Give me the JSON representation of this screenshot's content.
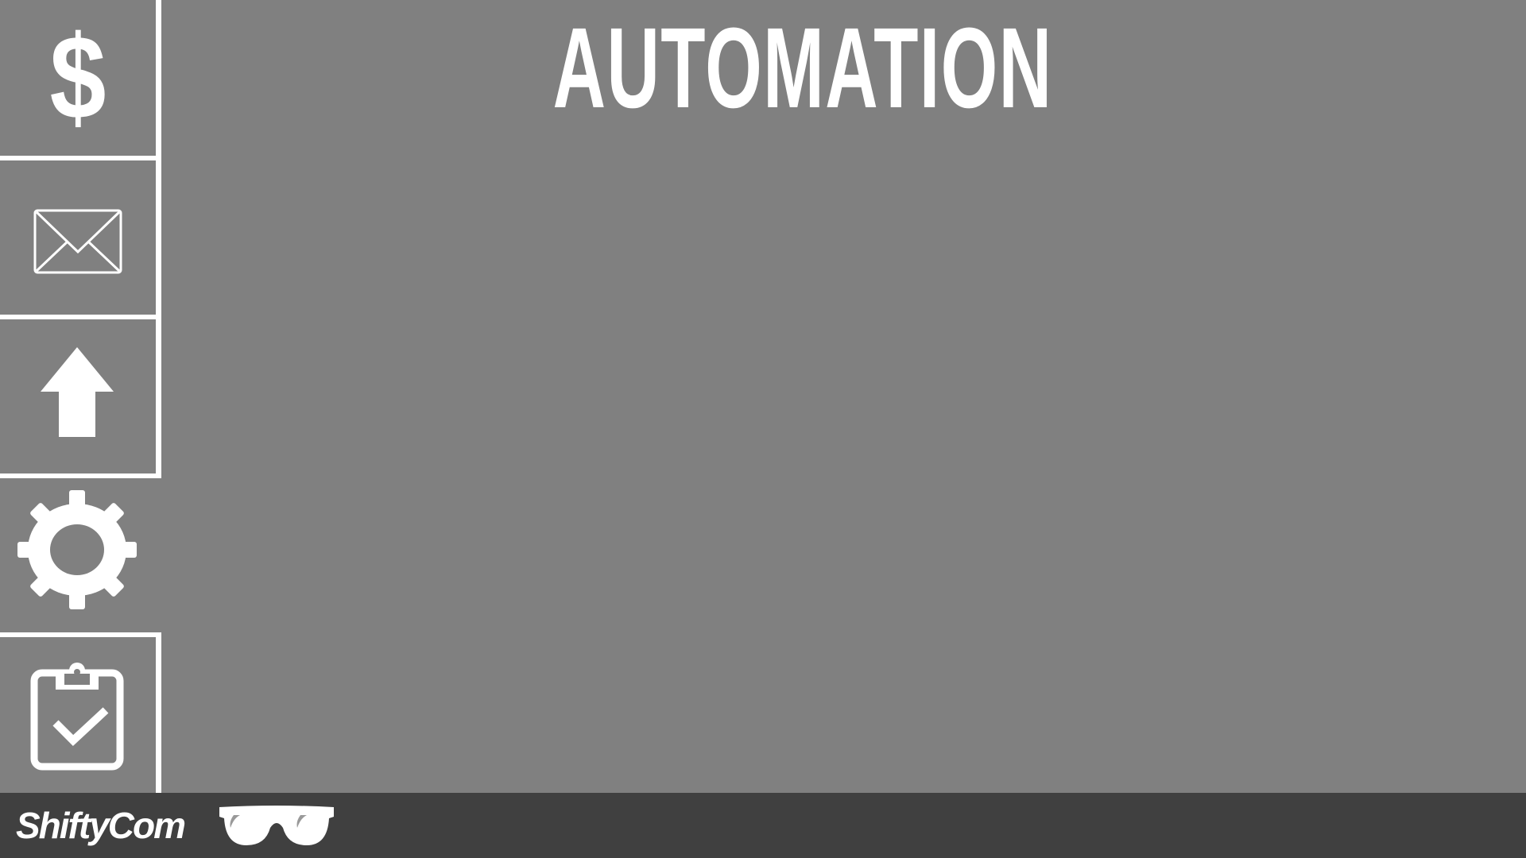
{
  "header": {
    "title": "AUTOMATION"
  },
  "sidebar": {
    "items": [
      {
        "icon": "dollar-icon",
        "glyph": "$"
      },
      {
        "icon": "envelope-icon"
      },
      {
        "icon": "upload-arrow-icon"
      },
      {
        "icon": "gear-icon"
      },
      {
        "icon": "clipboard-check-icon"
      }
    ]
  },
  "footer": {
    "brand": "ShiftyCom",
    "logo_icon": "sunglasses-icon"
  },
  "colors": {
    "background": "#808080",
    "footer": "#404040",
    "foreground": "#ffffff"
  }
}
